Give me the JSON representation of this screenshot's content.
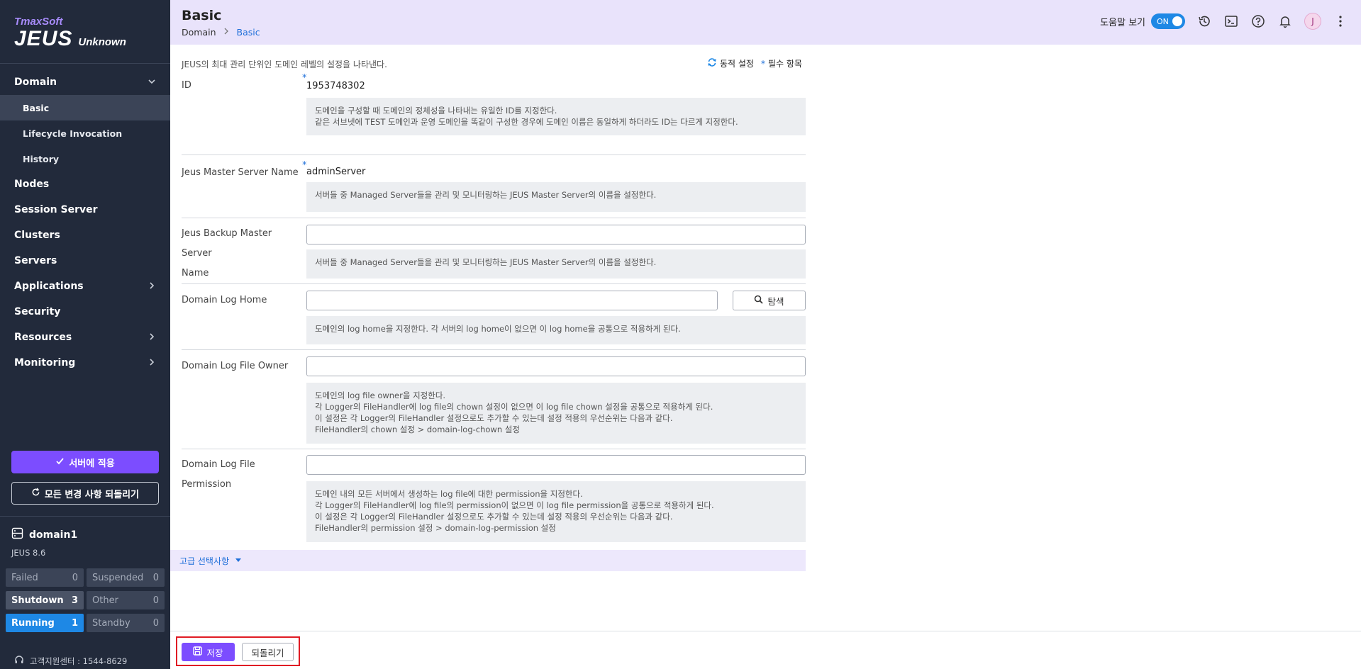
{
  "sidebar": {
    "logo_brand": "TmaxSoft",
    "logo_product": "JEUS",
    "logo_version": "Unknown",
    "nav": {
      "domain": "Domain",
      "basic": "Basic",
      "lifecycle": "Lifecycle Invocation",
      "history": "History",
      "nodes": "Nodes",
      "session_server": "Session Server",
      "clusters": "Clusters",
      "servers": "Servers",
      "applications": "Applications",
      "security": "Security",
      "resources": "Resources",
      "monitoring": "Monitoring"
    },
    "apply_button": "서버에 적용",
    "revert_all_button": "모든 변경 사항 되돌리기",
    "domain_name": "domain1",
    "jeus_version": "JEUS 8.6",
    "status": {
      "failed_label": "Failed",
      "failed_count": "0",
      "suspended_label": "Suspended",
      "suspended_count": "0",
      "shutdown_label": "Shutdown",
      "shutdown_count": "3",
      "other_label": "Other",
      "other_count": "0",
      "running_label": "Running",
      "running_count": "1",
      "standby_label": "Standby",
      "standby_count": "0"
    },
    "support": "고객지원센터 : 1544-8629"
  },
  "header": {
    "title": "Basic",
    "breadcrumb_home": "Domain",
    "breadcrumb_current": "Basic",
    "help_label": "도움말 보기",
    "help_toggle": "ON",
    "avatar_initial": "J"
  },
  "main": {
    "description": "JEUS의 최대 관리 단위인 도메인 레벨의 설정을 나타낸다.",
    "legend_dynamic": "동적 설정",
    "legend_required": "필수 항목",
    "fields": {
      "id": {
        "label": "ID",
        "value": "1953748302",
        "help1": "도메인을 구성할 때 도메인의 정체성을 나타내는 유일한 ID를 지정한다.",
        "help2": "같은 서브넷에 TEST 도메인과 운영 도메인을 똑같이 구성한 경우에 도메인 이름은 동일하게 하더라도 ID는 다르게 지정한다."
      },
      "master": {
        "label": "Jeus Master Server Name",
        "value": "adminServer",
        "help1": "서버들 중 Managed Server들을 관리 및 모니터링하는 JEUS Master Server의 이름을 설정한다."
      },
      "backup": {
        "label1": "Jeus Backup Master Server",
        "label2": "Name",
        "value": "",
        "help1": "서버들 중 Managed Server들을 관리 및 모니터링하는 JEUS Master Server의 이름을 설정한다."
      },
      "log_home": {
        "label": "Domain Log Home",
        "value": "",
        "search_button": "탐색",
        "help1": "도메인의 log home을 지정한다. 각 서버의 log home이 없으면 이 log home을 공통으로 적용하게 된다."
      },
      "log_owner": {
        "label": "Domain Log File Owner",
        "value": "",
        "help1": "도메인의 log file owner을 지정한다.",
        "help2": "각 Logger의 FileHandler에 log file의 chown 설정이 없으면 이 log file chown 설정을 공통으로 적용하게 된다.",
        "help3": "이 설정은 각 Logger의 FileHandler 설정으로도 추가할 수 있는데 설정 적용의 우선순위는 다음과 같다.",
        "help4": "FileHandler의 chown 설정 > domain-log-chown 설정"
      },
      "log_perm": {
        "label1": "Domain Log File",
        "label2": "Permission",
        "value": "",
        "help1": "도메인 내의 모든 서버에서 생성하는 log file에 대한 permission을 지정한다.",
        "help2": "각 Logger의 FileHandler에 log file의 permission이 없으면 이 log file permission을 공통으로 적용하게 된다.",
        "help3": "이 설정은 각 Logger의 FileHandler 설정으로도 추가할 수 있는데 설정 적용의 우선순위는 다음과 같다.",
        "help4": "FileHandler의 permission 설정 > domain-log-permission 설정"
      }
    },
    "advanced_label": "고급 선택사항"
  },
  "footer": {
    "save_button": "저장",
    "revert_button": "되돌리기"
  },
  "colors": {
    "sidebar_bg": "#222a3b",
    "header_bg": "#e9e3fb",
    "accent": "#7c4dff",
    "link": "#1e6fd9",
    "running": "#1e88e5",
    "highlight_border": "#e01b24"
  }
}
